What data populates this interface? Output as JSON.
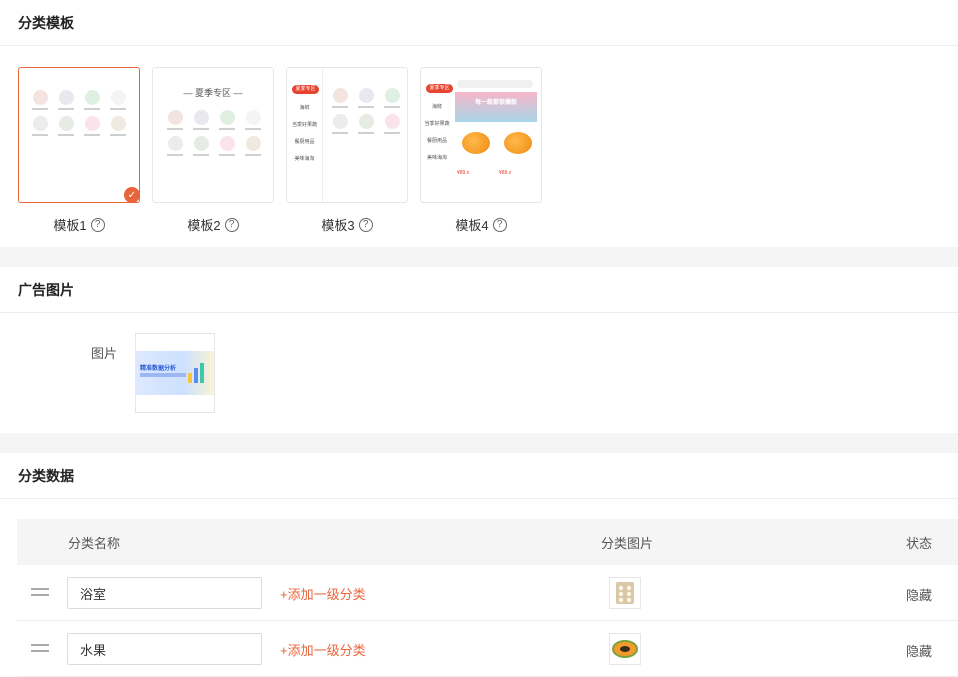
{
  "templates_section": {
    "title": "分类模板",
    "templates": [
      {
        "label": "模板1",
        "selected": true
      },
      {
        "label": "模板2",
        "selected": false,
        "preview_title": "夏季专区"
      },
      {
        "label": "模板3",
        "selected": false,
        "preview_tag": "夏季专区",
        "preview_menu": [
          "海鲜",
          "当季好果蔬",
          "餐厨用品",
          "美味海淘"
        ]
      },
      {
        "label": "模板4",
        "selected": false,
        "preview_tag": "夏季专区",
        "preview_menu": [
          "海鲜",
          "当季好果蔬",
          "餐厨用品",
          "美味海淘"
        ],
        "preview_banner": "每一款都很爆款",
        "preview_price": "¥89.x"
      }
    ],
    "help_icon": "help-circle-icon",
    "check_icon": "check-icon",
    "accent_color": "#e8643a"
  },
  "ad_section": {
    "title": "广告图片",
    "image_label": "图片",
    "ad_image_text": "精准数据分析"
  },
  "category_section": {
    "title": "分类数据",
    "columns": {
      "name": "分类名称",
      "image": "分类图片",
      "status": "状态"
    },
    "rows": [
      {
        "name": "浴室",
        "add_link": "+添加一级分类",
        "image_icon": "bath-product-icon",
        "status": "隐藏"
      },
      {
        "name": "水果",
        "add_link": "+添加一级分类",
        "image_icon": "papaya-icon",
        "status": "隐藏"
      }
    ]
  }
}
